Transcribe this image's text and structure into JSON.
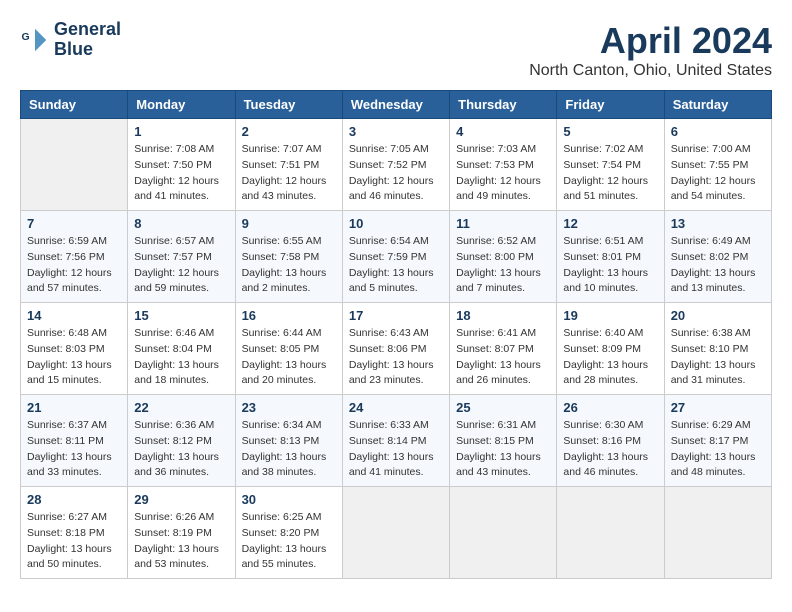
{
  "header": {
    "logo_line1": "General",
    "logo_line2": "Blue",
    "title": "April 2024",
    "location": "North Canton, Ohio, United States"
  },
  "calendar": {
    "days_of_week": [
      "Sunday",
      "Monday",
      "Tuesday",
      "Wednesday",
      "Thursday",
      "Friday",
      "Saturday"
    ],
    "weeks": [
      [
        {
          "day": "",
          "sunrise": "",
          "sunset": "",
          "daylight": ""
        },
        {
          "day": "1",
          "sunrise": "Sunrise: 7:08 AM",
          "sunset": "Sunset: 7:50 PM",
          "daylight": "Daylight: 12 hours and 41 minutes."
        },
        {
          "day": "2",
          "sunrise": "Sunrise: 7:07 AM",
          "sunset": "Sunset: 7:51 PM",
          "daylight": "Daylight: 12 hours and 43 minutes."
        },
        {
          "day": "3",
          "sunrise": "Sunrise: 7:05 AM",
          "sunset": "Sunset: 7:52 PM",
          "daylight": "Daylight: 12 hours and 46 minutes."
        },
        {
          "day": "4",
          "sunrise": "Sunrise: 7:03 AM",
          "sunset": "Sunset: 7:53 PM",
          "daylight": "Daylight: 12 hours and 49 minutes."
        },
        {
          "day": "5",
          "sunrise": "Sunrise: 7:02 AM",
          "sunset": "Sunset: 7:54 PM",
          "daylight": "Daylight: 12 hours and 51 minutes."
        },
        {
          "day": "6",
          "sunrise": "Sunrise: 7:00 AM",
          "sunset": "Sunset: 7:55 PM",
          "daylight": "Daylight: 12 hours and 54 minutes."
        }
      ],
      [
        {
          "day": "7",
          "sunrise": "Sunrise: 6:59 AM",
          "sunset": "Sunset: 7:56 PM",
          "daylight": "Daylight: 12 hours and 57 minutes."
        },
        {
          "day": "8",
          "sunrise": "Sunrise: 6:57 AM",
          "sunset": "Sunset: 7:57 PM",
          "daylight": "Daylight: 12 hours and 59 minutes."
        },
        {
          "day": "9",
          "sunrise": "Sunrise: 6:55 AM",
          "sunset": "Sunset: 7:58 PM",
          "daylight": "Daylight: 13 hours and 2 minutes."
        },
        {
          "day": "10",
          "sunrise": "Sunrise: 6:54 AM",
          "sunset": "Sunset: 7:59 PM",
          "daylight": "Daylight: 13 hours and 5 minutes."
        },
        {
          "day": "11",
          "sunrise": "Sunrise: 6:52 AM",
          "sunset": "Sunset: 8:00 PM",
          "daylight": "Daylight: 13 hours and 7 minutes."
        },
        {
          "day": "12",
          "sunrise": "Sunrise: 6:51 AM",
          "sunset": "Sunset: 8:01 PM",
          "daylight": "Daylight: 13 hours and 10 minutes."
        },
        {
          "day": "13",
          "sunrise": "Sunrise: 6:49 AM",
          "sunset": "Sunset: 8:02 PM",
          "daylight": "Daylight: 13 hours and 13 minutes."
        }
      ],
      [
        {
          "day": "14",
          "sunrise": "Sunrise: 6:48 AM",
          "sunset": "Sunset: 8:03 PM",
          "daylight": "Daylight: 13 hours and 15 minutes."
        },
        {
          "day": "15",
          "sunrise": "Sunrise: 6:46 AM",
          "sunset": "Sunset: 8:04 PM",
          "daylight": "Daylight: 13 hours and 18 minutes."
        },
        {
          "day": "16",
          "sunrise": "Sunrise: 6:44 AM",
          "sunset": "Sunset: 8:05 PM",
          "daylight": "Daylight: 13 hours and 20 minutes."
        },
        {
          "day": "17",
          "sunrise": "Sunrise: 6:43 AM",
          "sunset": "Sunset: 8:06 PM",
          "daylight": "Daylight: 13 hours and 23 minutes."
        },
        {
          "day": "18",
          "sunrise": "Sunrise: 6:41 AM",
          "sunset": "Sunset: 8:07 PM",
          "daylight": "Daylight: 13 hours and 26 minutes."
        },
        {
          "day": "19",
          "sunrise": "Sunrise: 6:40 AM",
          "sunset": "Sunset: 8:09 PM",
          "daylight": "Daylight: 13 hours and 28 minutes."
        },
        {
          "day": "20",
          "sunrise": "Sunrise: 6:38 AM",
          "sunset": "Sunset: 8:10 PM",
          "daylight": "Daylight: 13 hours and 31 minutes."
        }
      ],
      [
        {
          "day": "21",
          "sunrise": "Sunrise: 6:37 AM",
          "sunset": "Sunset: 8:11 PM",
          "daylight": "Daylight: 13 hours and 33 minutes."
        },
        {
          "day": "22",
          "sunrise": "Sunrise: 6:36 AM",
          "sunset": "Sunset: 8:12 PM",
          "daylight": "Daylight: 13 hours and 36 minutes."
        },
        {
          "day": "23",
          "sunrise": "Sunrise: 6:34 AM",
          "sunset": "Sunset: 8:13 PM",
          "daylight": "Daylight: 13 hours and 38 minutes."
        },
        {
          "day": "24",
          "sunrise": "Sunrise: 6:33 AM",
          "sunset": "Sunset: 8:14 PM",
          "daylight": "Daylight: 13 hours and 41 minutes."
        },
        {
          "day": "25",
          "sunrise": "Sunrise: 6:31 AM",
          "sunset": "Sunset: 8:15 PM",
          "daylight": "Daylight: 13 hours and 43 minutes."
        },
        {
          "day": "26",
          "sunrise": "Sunrise: 6:30 AM",
          "sunset": "Sunset: 8:16 PM",
          "daylight": "Daylight: 13 hours and 46 minutes."
        },
        {
          "day": "27",
          "sunrise": "Sunrise: 6:29 AM",
          "sunset": "Sunset: 8:17 PM",
          "daylight": "Daylight: 13 hours and 48 minutes."
        }
      ],
      [
        {
          "day": "28",
          "sunrise": "Sunrise: 6:27 AM",
          "sunset": "Sunset: 8:18 PM",
          "daylight": "Daylight: 13 hours and 50 minutes."
        },
        {
          "day": "29",
          "sunrise": "Sunrise: 6:26 AM",
          "sunset": "Sunset: 8:19 PM",
          "daylight": "Daylight: 13 hours and 53 minutes."
        },
        {
          "day": "30",
          "sunrise": "Sunrise: 6:25 AM",
          "sunset": "Sunset: 8:20 PM",
          "daylight": "Daylight: 13 hours and 55 minutes."
        },
        {
          "day": "",
          "sunrise": "",
          "sunset": "",
          "daylight": ""
        },
        {
          "day": "",
          "sunrise": "",
          "sunset": "",
          "daylight": ""
        },
        {
          "day": "",
          "sunrise": "",
          "sunset": "",
          "daylight": ""
        },
        {
          "day": "",
          "sunrise": "",
          "sunset": "",
          "daylight": ""
        }
      ]
    ]
  }
}
